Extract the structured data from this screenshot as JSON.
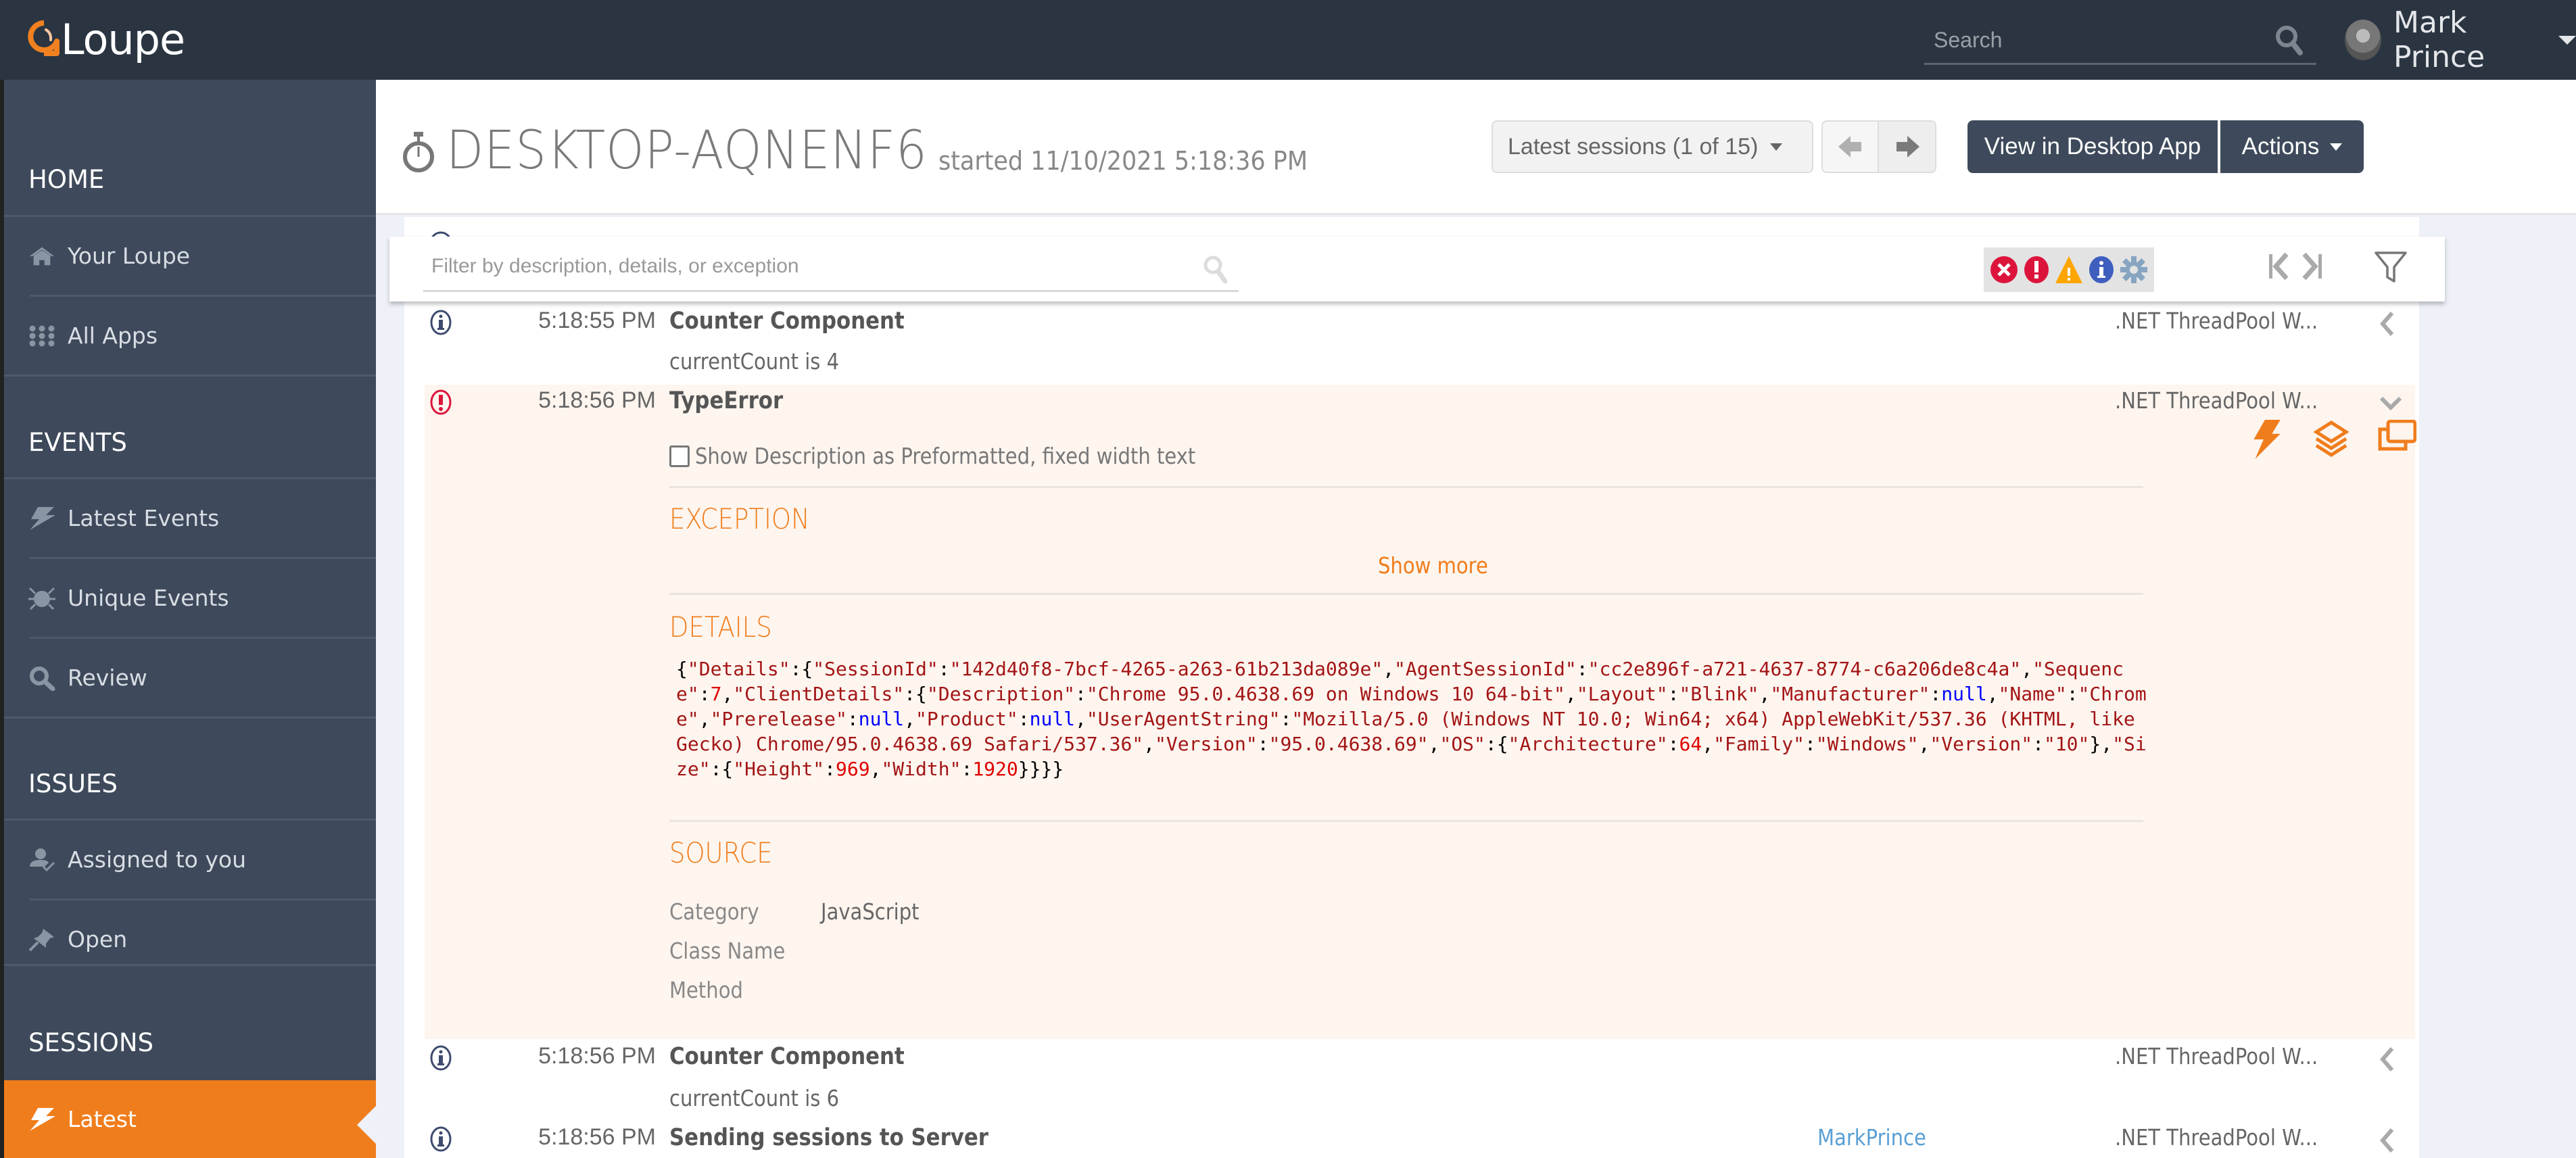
{
  "app": {
    "name": "Loupe",
    "search_placeholder": "Search",
    "user_name": "Mark Prince"
  },
  "sidebar": {
    "sections": [
      {
        "label": "HOME",
        "items": [
          {
            "label": "Your Loupe",
            "icon": "home-icon"
          },
          {
            "label": "All Apps",
            "icon": "grid-icon"
          }
        ]
      },
      {
        "label": "EVENTS",
        "items": [
          {
            "label": "Latest Events",
            "icon": "lightning-icon"
          },
          {
            "label": "Unique Events",
            "icon": "bug-icon"
          },
          {
            "label": "Review",
            "icon": "search-icon"
          }
        ]
      },
      {
        "label": "ISSUES",
        "items": [
          {
            "label": "Assigned to you",
            "icon": "user-check-icon"
          },
          {
            "label": "Open",
            "icon": "pin-icon"
          }
        ]
      },
      {
        "label": "SESSIONS",
        "items": [
          {
            "label": "Latest",
            "icon": "lightning-icon",
            "active": true
          }
        ]
      }
    ]
  },
  "header": {
    "title": "DESKTOP-AQNENF6",
    "subtitle": "started 11/10/2021 5:18:36 PM",
    "sessions_dropdown": "Latest sessions (1 of 15)",
    "view_desktop_label": "View in Desktop App",
    "actions_label": "Actions"
  },
  "filter": {
    "placeholder": "Filter by description, details, or exception",
    "value": "",
    "levels": [
      "critical",
      "error",
      "warning",
      "information",
      "verbose"
    ]
  },
  "events": [
    {
      "level": "information",
      "time": "5:18:55 PM",
      "caption": "Counter Component",
      "description": "currentCount is 4",
      "thread": ".NET ThreadPool W...",
      "user": ""
    },
    {
      "level": "error",
      "time": "5:18:56 PM",
      "caption": "TypeError",
      "thread": ".NET ThreadPool W...",
      "expanded": true,
      "detail": {
        "preformatted_label": "Show Description as Preformatted, fixed width text",
        "preformatted_checked": false,
        "exception_title": "EXCEPTION",
        "show_more": "Show more",
        "details_title": "DETAILS",
        "details_json": "{\"Details\":{\"SessionId\":\"142d40f8-7bcf-4265-a263-61b213da089e\",\"AgentSessionId\":\"cc2e896f-a721-4637-8774-c6a206de8c4a\",\"Sequence\":7,\"ClientDetails\":{\"Description\":\"Chrome 95.0.4638.69 on Windows 10 64-bit\",\"Layout\":\"Blink\",\"Manufacturer\":null,\"Name\":\"Chrome\",\"Prerelease\":null,\"Product\":null,\"UserAgentString\":\"Mozilla/5.0 (Windows NT 10.0; Win64; x64) AppleWebKit/537.36 (KHTML, like Gecko) Chrome/95.0.4638.69 Safari/537.36\",\"Version\":\"95.0.4638.69\",\"OS\":{\"Architecture\":64,\"Family\":\"Windows\",\"Version\":\"10\"},\"Size\":{\"Height\":969,\"Width\":1920}}}}",
        "source_title": "SOURCE",
        "source": [
          {
            "label": "Category",
            "value": "JavaScript"
          },
          {
            "label": "Class Name",
            "value": ""
          },
          {
            "label": "Method",
            "value": ""
          }
        ]
      }
    },
    {
      "level": "information",
      "time": "5:18:56 PM",
      "caption": "Counter Component",
      "description": "currentCount is 6",
      "thread": ".NET ThreadPool W...",
      "user": ""
    },
    {
      "level": "information",
      "time": "5:18:56 PM",
      "caption": "Sending sessions to Server",
      "description": "",
      "thread": ".NET ThreadPool W...",
      "user": "MarkPrince"
    }
  ],
  "colors": {
    "accent": "#f07d1c",
    "topbar": "#2b3542",
    "sidebar": "#3e4a5b",
    "error": "#dc143c",
    "warning": "#ffa500",
    "info": "#3f5fbf",
    "verbose": "#87a5c0",
    "expanded_bg": "#fef5ef"
  }
}
